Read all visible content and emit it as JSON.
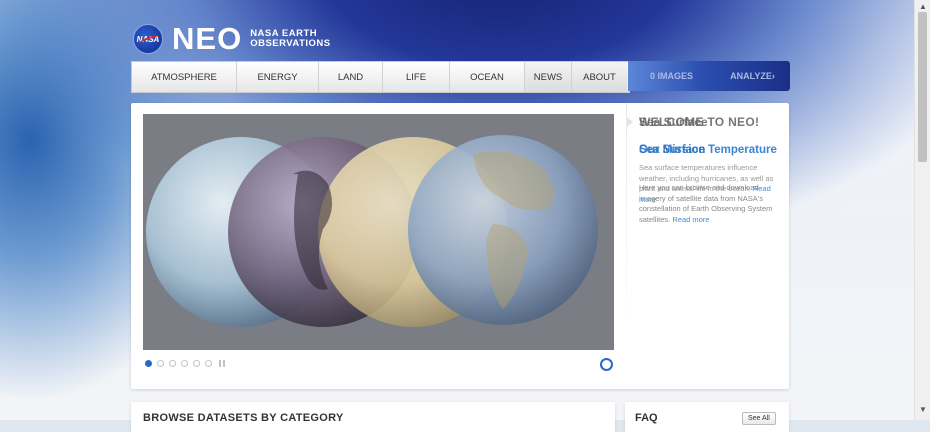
{
  "header": {
    "agency_mark": "NASA",
    "logo_text": "NEO",
    "logo_subtitle_line1": "NASA EARTH",
    "logo_subtitle_line2": "OBSERVATIONS"
  },
  "nav": {
    "items": [
      {
        "label": "ATMOSPHERE"
      },
      {
        "label": "ENERGY"
      },
      {
        "label": "LAND"
      },
      {
        "label": "LIFE"
      },
      {
        "label": "OCEAN"
      },
      {
        "label": "NEWS"
      },
      {
        "label": "ABOUT"
      }
    ],
    "tools": [
      {
        "label": "0 IMAGES"
      },
      {
        "label": "ANALYZE"
      }
    ],
    "tools_chevron": "›"
  },
  "slideshow": {
    "slide_count": 6,
    "active_index": 0
  },
  "welcome": {
    "title": "WELCOME TO NEO!",
    "overlay_title": "Sea Surface",
    "feature_title": "Sea Surface Temperature",
    "overlay_feature_title": "Our Mission",
    "feature_text": "Sea surface temperatures influence weather, including hurricanes, as well as plant and animal life in the ocean.",
    "feature_more": "Read more",
    "text": "Here you can browse and download imagery of satellite data from NASA's constellation of Earth Observing System satellites.",
    "text_more": "Read more"
  },
  "browse": {
    "title": "BROWSE DATASETS BY CATEGORY"
  },
  "faq": {
    "title": "FAQ",
    "see_all_label": "See All"
  },
  "scrollbar": {
    "up": "▲",
    "down": "▼"
  },
  "colors": {
    "accent": "#2868c8",
    "link": "#3d86d2",
    "header_dark": "#14206a"
  }
}
